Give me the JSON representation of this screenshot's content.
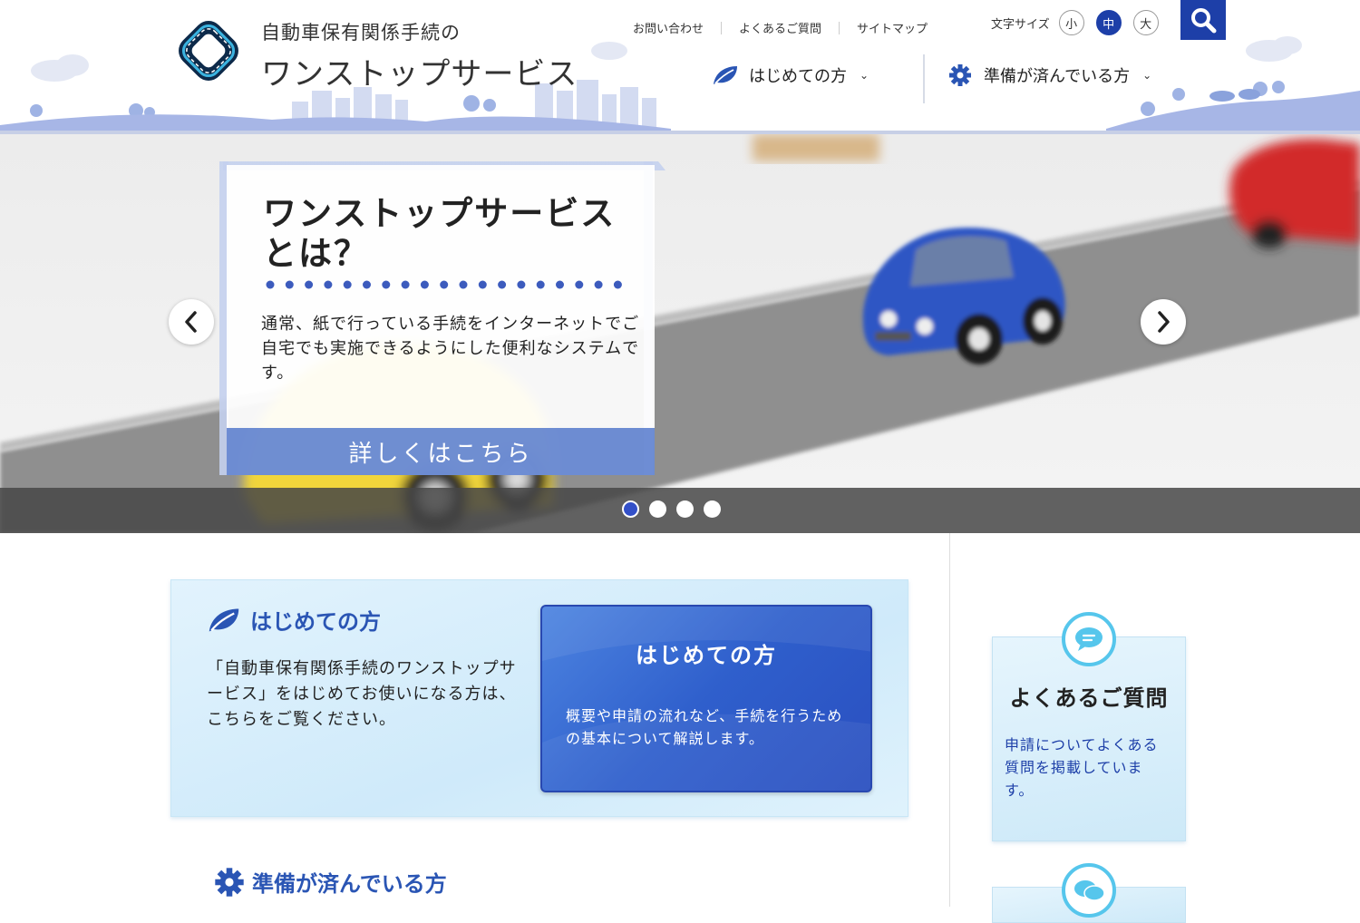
{
  "brand": {
    "sub_title": "自動車保有関係手続の",
    "main_title": "ワンストップサービス",
    "logo_icon": "road-diamond-logo"
  },
  "utility_nav": {
    "contact": "お問い合わせ",
    "faq": "よくあるご質問",
    "sitemap": "サイトマップ"
  },
  "font_size": {
    "label": "文字サイズ",
    "small": "小",
    "medium": "中",
    "large": "大",
    "selected": "中"
  },
  "search": {
    "icon": "search-icon"
  },
  "main_nav": {
    "first_time": "はじめての方",
    "ready": "準備が済んでいる方"
  },
  "hero": {
    "title_line1": "ワンストップサービス",
    "title_line2": "とは？",
    "description": "通常、紙で行っている手続をインターネットでご自宅でも実施できるようにした便利なシステムです。",
    "more_label": "詳しくはこちら",
    "slide_count": 4,
    "active_slide": 1
  },
  "intro": {
    "heading": "はじめての方",
    "text": "「自動車保有関係手続のワンストップサービス」をはじめてお使いになる方は、こちらをご覧ください。",
    "card_title": "はじめての方",
    "card_desc": "概要や申請の流れなど、手続を行うための基本について解説します。"
  },
  "ready_section": {
    "heading": "準備が済んでいる方"
  },
  "faq_card": {
    "title": "よくあるご質問",
    "desc": "申請についてよくある質問を掲載しています。"
  },
  "colors": {
    "brand_blue": "#1d3fa8",
    "accent_blue": "#2a55b4",
    "cyan": "#56c6ec"
  }
}
